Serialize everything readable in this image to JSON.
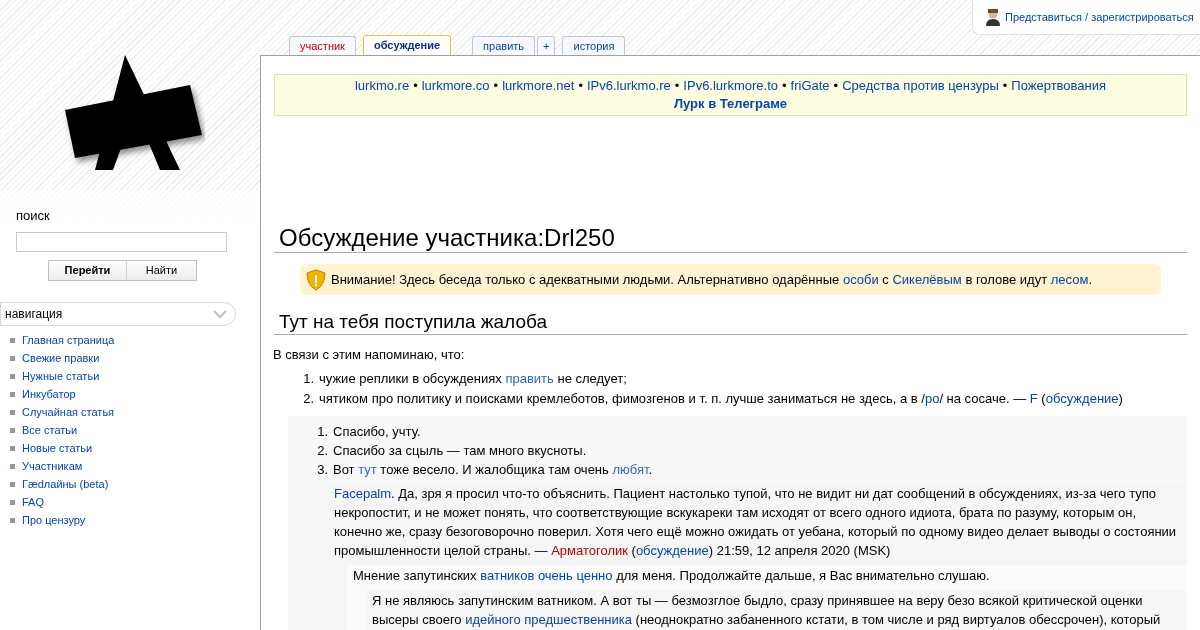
{
  "personal_tools": {
    "label": "Представиться / зарегистрироваться"
  },
  "tabs": [
    {
      "label": "участник",
      "selected": false,
      "exists": false,
      "kind": "tab"
    },
    {
      "label": "обсуждение",
      "selected": true,
      "exists": true,
      "kind": "tab"
    },
    {
      "label": "править",
      "selected": false,
      "exists": true,
      "kind": "tab"
    },
    {
      "label": "+",
      "selected": false,
      "exists": true,
      "kind": "small"
    },
    {
      "label": "история",
      "selected": false,
      "exists": true,
      "kind": "tab"
    }
  ],
  "sidebar": {
    "search": {
      "title": "поиск",
      "go": "Перейти",
      "find": "Найти"
    },
    "nav_title": "навигация",
    "items": [
      "Главная страница",
      "Свежие правки",
      "Нужные статьи",
      "Инкубатор",
      "Случайная статья",
      "Все статьи",
      "Новые статьи",
      "Участникам",
      "Гædлайны (beta)",
      "FAQ",
      "Про цензуру"
    ]
  },
  "banner": {
    "links": [
      "lurkmo.re",
      "lurkmore.co",
      "lurkmore.net",
      "IPv6.lurkmo.re",
      "IPv6.lurkmore.to",
      "friGate",
      "Средства против цензуры",
      "Пожертвования"
    ],
    "separator": "•",
    "bold_link": "Лурк в Телеграме"
  },
  "page_title": "Обсуждение участника:Drl250",
  "warning": [
    {
      "text": "Внимание! Здесь беседа только с адекватными людьми. Альтернативно одарённые ",
      "kind": "text"
    },
    {
      "text": "особи",
      "kind": "link"
    },
    {
      "text": " с ",
      "kind": "text"
    },
    {
      "text": "Сикелёвым",
      "kind": "link"
    },
    {
      "text": " в голове идут ",
      "kind": "text"
    },
    {
      "text": "лесом",
      "kind": "link"
    },
    {
      "text": ".",
      "kind": "text"
    }
  ],
  "section": {
    "title": "Тут на тебя поступила жалоба",
    "intro": "В связи с этим напоминаю, что:",
    "list": [
      {
        "number": "1.",
        "parts": [
          {
            "text": "чужие реплики в обсуждениях ",
            "kind": "text"
          },
          {
            "text": "править",
            "kind": "extlink"
          },
          {
            "text": " не следует;",
            "kind": "text"
          }
        ]
      },
      {
        "number": "2.",
        "parts": [
          {
            "text": "чятиком про политику и поисками кремлеботов, фимозгенов и т. п. лучше заниматься не здесь, а в /",
            "kind": "text"
          },
          {
            "text": "po",
            "kind": "link"
          },
          {
            "text": "/ на сосаче. — ",
            "kind": "text"
          },
          {
            "text": "F",
            "kind": "link"
          },
          {
            "text": " (",
            "kind": "text"
          },
          {
            "text": "обсуждение",
            "kind": "link"
          },
          {
            "text": ")",
            "kind": "text"
          }
        ]
      }
    ],
    "reply": {
      "list": [
        {
          "number": "1.",
          "parts": [
            {
              "text": "Спасибо, учту.",
              "kind": "text"
            }
          ]
        },
        {
          "number": "2.",
          "parts": [
            {
              "text": "Спасибо за сцыль — там много вкусноты.",
              "kind": "text"
            }
          ]
        },
        {
          "number": "3.",
          "parts": [
            {
              "text": "Вот ",
              "kind": "text"
            },
            {
              "text": "тут",
              "kind": "extlink"
            },
            {
              "text": " тоже весело. И жалобщика там очень ",
              "kind": "text"
            },
            {
              "text": "любят",
              "kind": "extlink"
            },
            {
              "text": ".",
              "kind": "text"
            }
          ]
        }
      ],
      "children": [
        {
          "parts": [
            {
              "text": "Facepalm",
              "kind": "link"
            },
            {
              "text": ". Да, зря я просил что-то объяснить. Пациент настолько тупой, что не видит ни дат сообщений в обсуждениях, из-за чего тупо некропостит, и не может понять, что соответствующие вскукареки там исходят от всего одного идиота, брата по разуму, которым он, конечно же, сразу безоговорочно поверил. Хотя чего ещё можно ожидать от уебана, который по одному видео делает выводы о состоянии промышленности целой страны. — ",
              "kind": "text"
            },
            {
              "text": "Арматоголик",
              "kind": "redlink"
            },
            {
              "text": " (",
              "kind": "text"
            },
            {
              "text": "обсуждение",
              "kind": "link"
            },
            {
              "text": ") 21:59, 12 апреля 2020 (MSK)",
              "kind": "text"
            }
          ],
          "children": [
            {
              "parts": [
                {
                  "text": "Мнение запутинских ",
                  "kind": "text"
                },
                {
                  "text": "ватников очень ценно",
                  "kind": "link"
                },
                {
                  "text": " для меня. Продолжайте дальше, я Вас внимательно слушаю.",
                  "kind": "text"
                }
              ],
              "children": [
                {
                  "parts": [
                    {
                      "text": "Я не являюсь запутинским ватником. А вот ты — безмозглое быдло, сразу принявшее на веру безо всякой критической оценки высеры своего ",
                      "kind": "text"
                    },
                    {
                      "text": "идейного предшественника",
                      "kind": "link"
                    },
                    {
                      "text": " (неоднократно забаненного кстати, в том числе и ряд виртуалов обессрочен), который",
                      "kind": "text"
                    }
                  ]
                }
              ]
            }
          ]
        }
      ]
    }
  }
}
